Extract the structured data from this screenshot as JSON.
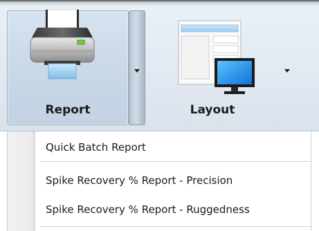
{
  "ribbon": {
    "report_label": "Report",
    "report_icon": "printer-icon",
    "layout_label": "Layout",
    "layout_icon": "layout-monitor-icon"
  },
  "menu": {
    "items": [
      {
        "label": "Quick Batch Report"
      },
      {
        "label": "Spike Recovery % Report - Precision"
      },
      {
        "label": "Spike Recovery % Report - Ruggedness"
      }
    ]
  },
  "colors": {
    "ribbon_bg": "#e2e9f2",
    "pressed_button_bg": "#cbd9e8",
    "printer_status_light": "#6fd63a",
    "monitor_screen": "#1f8fe6",
    "menu_gutter": "#ececec"
  }
}
